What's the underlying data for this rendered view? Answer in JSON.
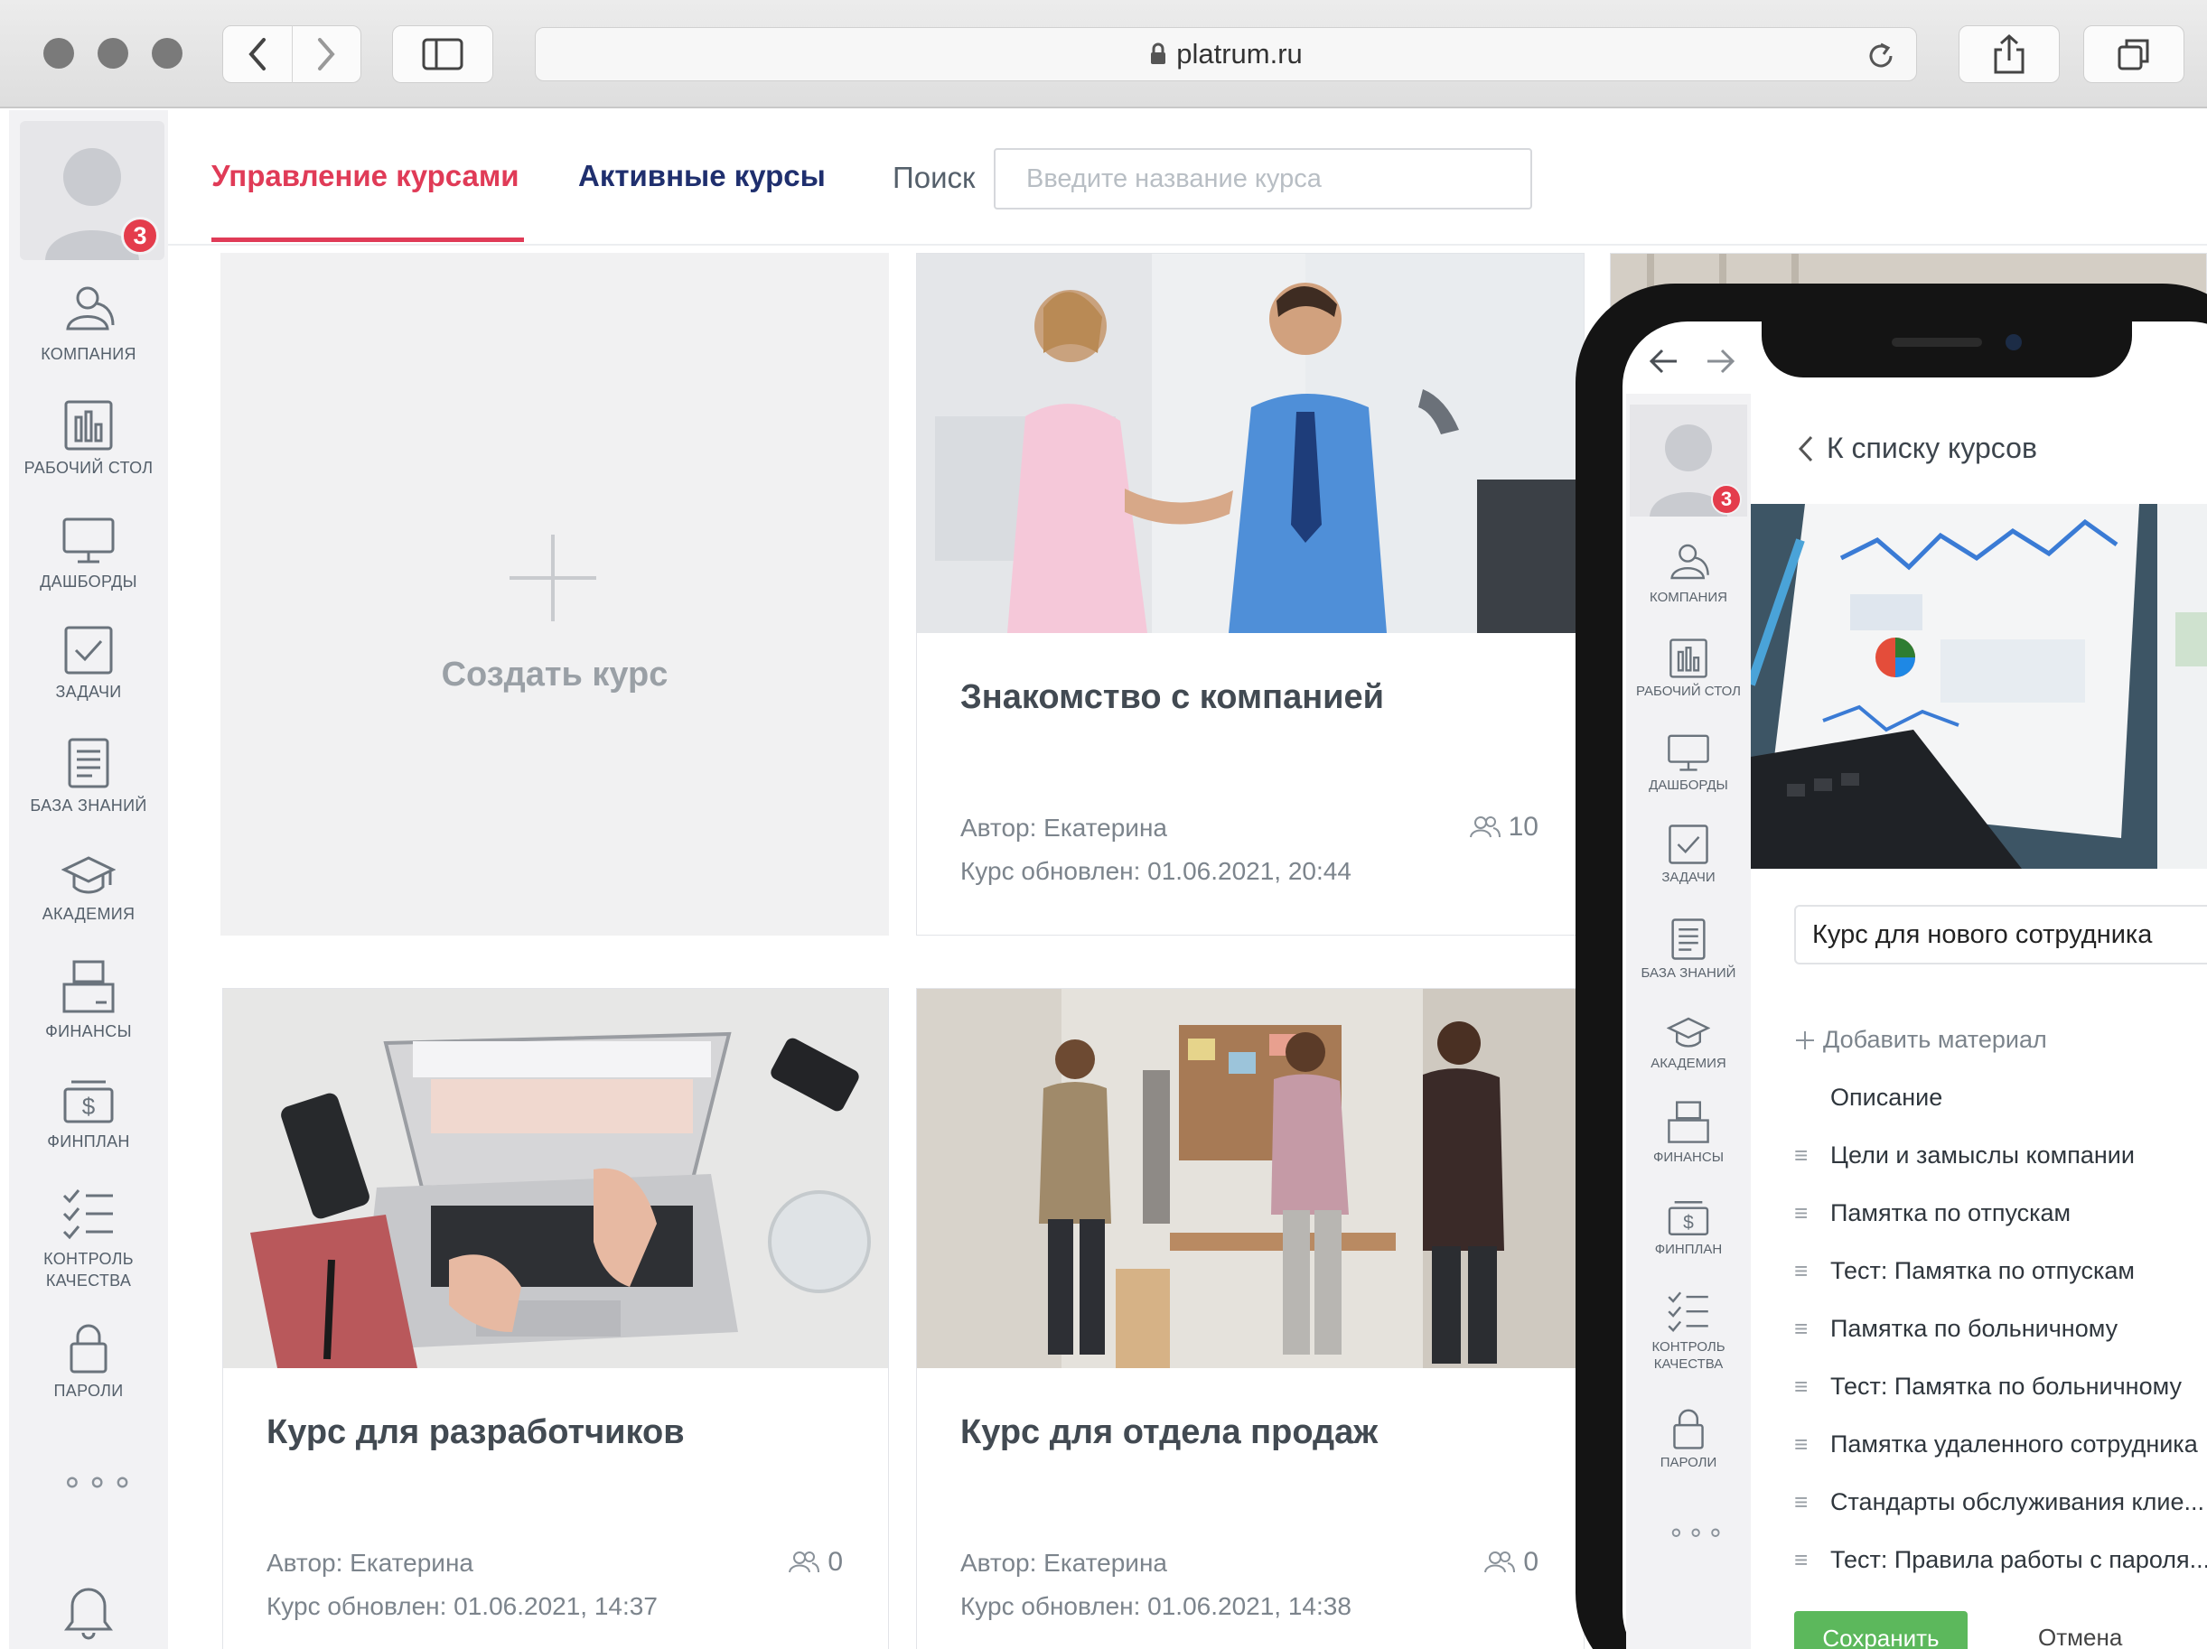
{
  "browser": {
    "url": "platrum.ru"
  },
  "header": {
    "tabs": [
      {
        "label": "Управление курсами",
        "active": true
      },
      {
        "label": "Активные курсы",
        "active": false
      }
    ],
    "search_label": "Поиск",
    "search_placeholder": "Введите название курса"
  },
  "user": {
    "badge_count": "3"
  },
  "sidebar": {
    "items": [
      {
        "label": "Компания",
        "icon": "company-icon"
      },
      {
        "label": "Рабочий стол",
        "icon": "desktop-icon"
      },
      {
        "label": "Дашборды",
        "icon": "monitor-icon"
      },
      {
        "label": "Задачи",
        "icon": "tasks-icon"
      },
      {
        "label": "База знаний",
        "icon": "knowledge-base-icon"
      },
      {
        "label": "Академия",
        "icon": "academy-icon"
      },
      {
        "label": "Финансы",
        "icon": "finance-icon"
      },
      {
        "label": "Финплан",
        "icon": "finplan-icon"
      },
      {
        "label": "Контроль качества",
        "icon": "quality-control-icon"
      },
      {
        "label": "Пароли",
        "icon": "lock-icon"
      }
    ],
    "more": "∘∘∘"
  },
  "courses": {
    "create_label": "Создать курс",
    "cards": [
      {
        "title": "Знакомство с компанией",
        "author": "Автор: Екатерина",
        "updated": "Курс обновлен: 01.06.2021, 20:44",
        "participants": "10"
      },
      {
        "title": "Курс для разработчиков",
        "author": "Автор: Екатерина",
        "updated": "Курс обновлен: 01.06.2021, 14:37",
        "participants": "0"
      },
      {
        "title": "Курс для отдела продаж",
        "author": "Автор: Екатерина",
        "updated": "Курс обновлен: 01.06.2021, 14:38",
        "participants": "0"
      }
    ]
  },
  "phone": {
    "back_label": "К списку курсов",
    "course_name": "Курс для нового сотрудника",
    "add_material": "Добавить материал",
    "description": "Описание",
    "materials": [
      "Цели и замыслы компании",
      "Памятка по отпускам",
      "Тест: Памятка по отпускам",
      "Памятка по больничному",
      "Тест: Памятка по больничному",
      "Памятка удаленного сотрудника",
      "Стандарты обслуживания клие...",
      "Тест: Правила работы с пароля..."
    ],
    "save": "Сохранить",
    "cancel": "Отмена"
  },
  "colors": {
    "accent": "#e03b57",
    "nav_blue": "#1f2f6e",
    "save_green": "#5cb85c",
    "badge": "#e43c4c"
  }
}
